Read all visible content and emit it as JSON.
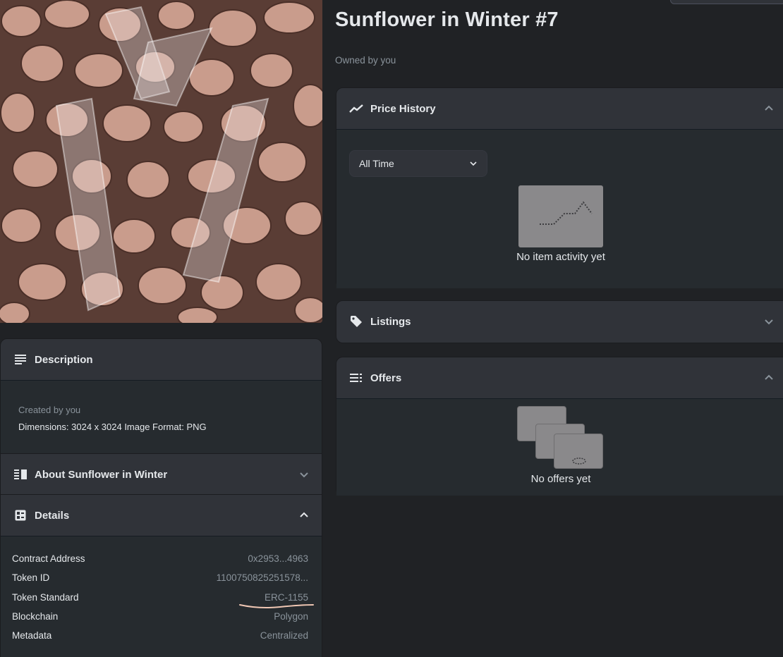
{
  "item": {
    "title": "Sunflower in Winter #7",
    "owned_by": "Owned by you",
    "image_name": "rocks-and-ice-artwork"
  },
  "description": {
    "header": "Description",
    "created_by": "Created by you",
    "dimensions": "Dimensions: 3024 x 3024 Image Format: PNG"
  },
  "about": {
    "header": "About Sunflower in Winter"
  },
  "details": {
    "header": "Details",
    "rows": [
      {
        "key": "Contract Address",
        "value": "0x2953...4963"
      },
      {
        "key": "Token ID",
        "value": "1100750825251578..."
      },
      {
        "key": "Token Standard",
        "value": "ERC-1155"
      },
      {
        "key": "Blockchain",
        "value": "Polygon"
      },
      {
        "key": "Metadata",
        "value": "Centralized"
      }
    ]
  },
  "price_history": {
    "header": "Price History",
    "filter_value": "All Time",
    "empty_text": "No item activity yet"
  },
  "listings": {
    "header": "Listings"
  },
  "offers": {
    "header": "Offers",
    "empty_text": "No offers yet"
  },
  "colors": {
    "page_bg": "#202225",
    "panel_header_bg": "#303339",
    "panel_body_bg": "#262b2f",
    "text_primary": "#e5e8eb",
    "text_secondary": "#8a939b",
    "annotation": "#f0c7b4"
  }
}
